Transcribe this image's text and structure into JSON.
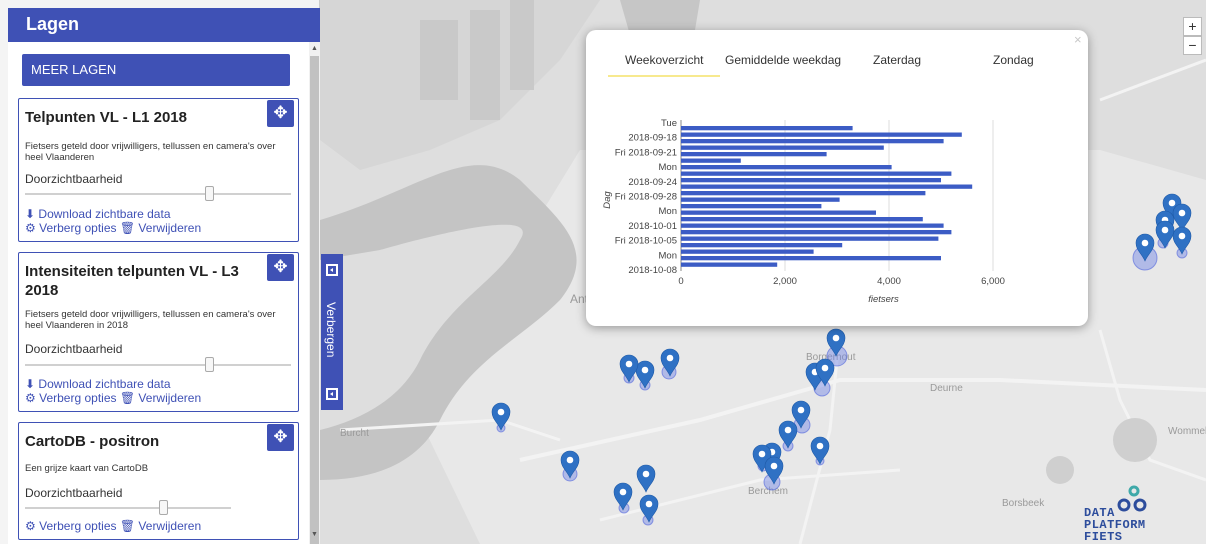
{
  "sidebar": {
    "header": "Lagen",
    "more_button": "MEER LAGEN",
    "layers": [
      {
        "title_lines": [
          "Telpunten VL - L1 2018"
        ],
        "description": "Fietsers geteld door vrijwilligers, tellussen en camera's over heel Vlaanderen",
        "opacity_label": "Doorzichtbaarheid",
        "opacity": 0.68,
        "download": "Download zichtbare data",
        "hide_options": "Verberg opties",
        "remove": "Verwijderen"
      },
      {
        "title_lines": [
          "Intensiteiten telpunten VL - L3",
          "2018"
        ],
        "description": "Fietsers geteld door vrijwilligers, tellussen en camera's over heel Vlaanderen in 2018",
        "opacity_label": "Doorzichtbaarheid",
        "opacity": 0.68,
        "download": "Download zichtbare data",
        "hide_options": "Verberg opties",
        "remove": "Verwijderen"
      },
      {
        "title_lines": [
          "CartoDB - positron"
        ],
        "description": "Een grijze kaart van CartoDB",
        "opacity_label": "Doorzichtbaarheid",
        "opacity": 0.68,
        "hide_options": "Verberg opties",
        "remove": "Verwijderen"
      }
    ]
  },
  "toggle_label": "Verbergen",
  "zoom": {
    "in": "+",
    "out": "−"
  },
  "popup": {
    "close": "×",
    "tabs": [
      "Weekoverzicht",
      "Gemiddelde weekdag",
      "Zaterdag",
      "Zondag"
    ],
    "active_tab": "Weekoverzicht"
  },
  "map_labels": [
    "Borgerhout",
    "Deurne",
    "Berchem",
    "Borsbeek",
    "Burcht",
    "Wommelgem",
    "Antwerpen"
  ],
  "logo_lines": [
    "DATA",
    "PLATFORM",
    "FIETS"
  ],
  "colors": {
    "primary": "#3f51b5",
    "bar": "#3c5cc5",
    "marker": "#2f71c4"
  },
  "chart_data": {
    "type": "bar",
    "orientation": "horizontal",
    "ylabel": "Dag",
    "xlabel": "fietsers",
    "xlim": [
      0,
      6000
    ],
    "xticks": [
      "0",
      "2,000",
      "4,000",
      "6,000"
    ],
    "yticks": [
      "Tue",
      "2018-09-18",
      "Fri 2018-09-21",
      "Mon",
      "2018-09-24",
      "Fri 2018-09-28",
      "Mon",
      "2018-10-01",
      "Fri 2018-10-05",
      "Mon",
      "2018-10-08"
    ],
    "values": [
      3300,
      5400,
      5050,
      3900,
      2800,
      1150,
      4050,
      5200,
      5000,
      5600,
      4700,
      3050,
      2700,
      3750,
      4650,
      5050,
      5200,
      4950,
      3100,
      2550,
      5000,
      1850
    ]
  }
}
